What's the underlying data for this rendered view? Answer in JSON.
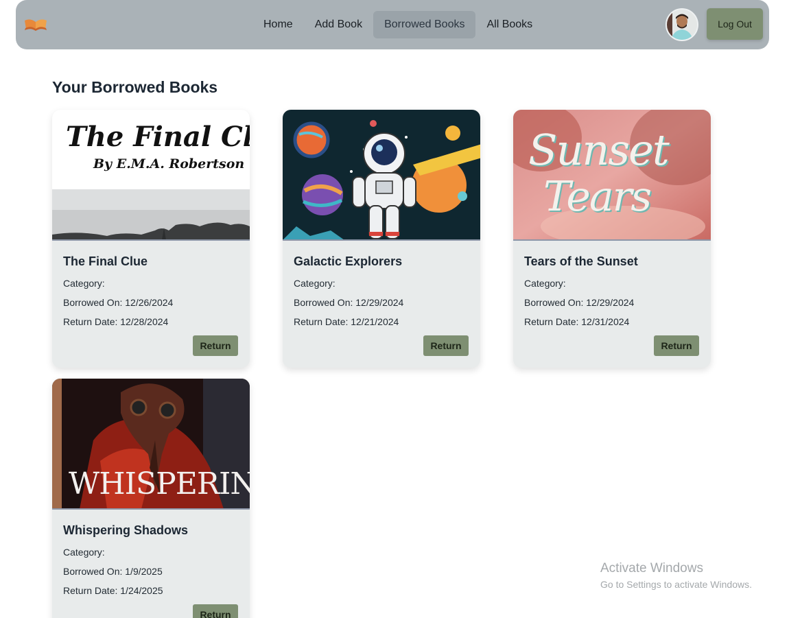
{
  "nav": {
    "logo_icon": "open-book-icon",
    "links": [
      "Home",
      "Add Book",
      "Borrowed Books",
      "All Books"
    ],
    "active": "Borrowed Books",
    "logout_label": "Log Out"
  },
  "page": {
    "title": "Your Borrowed Books"
  },
  "books": [
    {
      "title": "The Final Clue",
      "cover_title": "The Final Clue",
      "cover_author": "By E.M.A. Robertson",
      "category": "Category:",
      "borrowed": "Borrowed On: 12/26/2024",
      "return_date": "Return Date: 12/28/2024",
      "button": "Return"
    },
    {
      "title": "Galactic Explorers",
      "category": "Category:",
      "borrowed": "Borrowed On: 12/29/2024",
      "return_date": "Return Date: 12/21/2024",
      "button": "Return"
    },
    {
      "title": "Tears of the Sunset",
      "cover_title_1": "Sunset",
      "cover_title_2": "Tears",
      "category": "Category:",
      "borrowed": "Borrowed On: 12/29/2024",
      "return_date": "Return Date: 12/31/2024",
      "button": "Return"
    },
    {
      "title": "Whispering Shadows",
      "cover_title": "WHISPERING",
      "category": "Category:",
      "borrowed": "Borrowed On: 1/9/2025",
      "return_date": "Return Date: 1/24/2025",
      "button": "Return"
    }
  ],
  "watermark": {
    "line1": "Activate Windows",
    "line2": "Go to Settings to activate Windows."
  },
  "colors": {
    "navbar": "#aab2b7",
    "accent_button": "#7e8f72",
    "card_bg": "#e8ebeb"
  }
}
